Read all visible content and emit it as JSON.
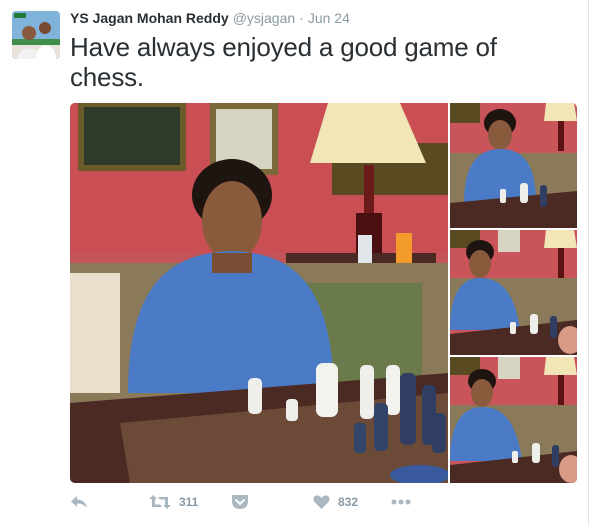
{
  "tweet": {
    "author_name": "YS Jagan Mohan Reddy",
    "handle": "@ysjagan",
    "separator": "·",
    "date": "Jun 24",
    "text": "Have always enjoyed a good game of chess."
  },
  "actions": {
    "retweet_count": "311",
    "like_count": "832"
  },
  "icons": {
    "reply": "reply-icon",
    "retweet": "retweet-icon",
    "save": "pocket-icon",
    "like": "heart-icon",
    "more": "more-dots-icon"
  },
  "colors": {
    "name_text": "#292f33",
    "muted": "#8899a6",
    "photo_wall": "#c2545a"
  }
}
